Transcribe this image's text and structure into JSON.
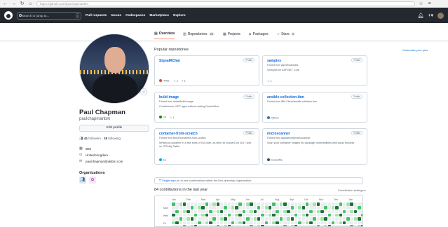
{
  "browser": {
    "url": "https://github.com/pauchapmanbm"
  },
  "header": {
    "search_placeholder": "Search or jump to...",
    "slash": "/",
    "nav": [
      "Pull requests",
      "Issues",
      "Codespaces",
      "Marketplace",
      "Explore"
    ]
  },
  "tabs": [
    {
      "label": "Overview",
      "icon": "book-icon",
      "active": true
    },
    {
      "label": "Repositories",
      "icon": "repo-icon",
      "count": "90"
    },
    {
      "label": "Projects",
      "icon": "table-icon"
    },
    {
      "label": "Packages",
      "icon": "package-icon"
    },
    {
      "label": "Stars",
      "icon": "star-icon",
      "count": "3"
    }
  ],
  "profile": {
    "name": "Paul Chapman",
    "login": "paulchapmanbm",
    "edit_label": "Edit profile",
    "followers": "41",
    "followers_label": "followers",
    "following": "19",
    "following_label": "following",
    "company": "IBM",
    "location": "United Kingdom",
    "email": "paulchapman@ukibm.com",
    "orgs_title": "Organizations"
  },
  "popular": {
    "title": "Popular repositories",
    "customize": "Customize your pins",
    "repos": [
      {
        "name": "SignalRChat",
        "badge": "Public",
        "desc": "",
        "lang": "HTML",
        "color": "#e34c26",
        "stars": "2",
        "forks": "3"
      },
      {
        "name": "samples",
        "badge": "Public",
        "fork": "Forked from aspnet/samples",
        "desc": "Samples for ASP.NET Core",
        "lang": "",
        "color": "",
        "stars": "1",
        "forks": ""
      },
      {
        "name": "build-image",
        "badge": "Public",
        "fork": "Forked from dotnet/build-image",
        "desc": "Containerize .NET apps without writing Dockerfiles.",
        "lang": "C#",
        "color": "#178600",
        "stars": "1",
        "forks": ""
      },
      {
        "name": "ansible-collection-ibm",
        "badge": "Public",
        "fork": "Forked from IBM-Cloud/ansible-collection-ibm",
        "desc": "",
        "lang": "Python",
        "color": "#3572A5",
        "stars": "",
        "forks": ""
      },
      {
        "name": "container-from-scratch",
        "badge": "Public",
        "fork": "Forked from lizrice/containers-from-scratch",
        "desc": "Writing a container in a few lines of Go code, as seen at DockerCon 2017 and on O'Reilly Safari",
        "lang": "Go",
        "color": "#00ADD8",
        "stars": "",
        "forks": ""
      },
      {
        "name": "microscanner",
        "badge": "Public",
        "fork": "Forked from aquasecurity/microscanner",
        "desc": "Scan your container images for package vulnerabilities with Aqua Security",
        "lang": "Dockerfile",
        "color": "#384d54",
        "stars": "",
        "forks": ""
      }
    ]
  },
  "banner": {
    "link": "Single sign-on",
    "text": "to see contributions within the ibm-openslap organization."
  },
  "contrib": {
    "title": "84 contributions in the last year",
    "settings": "Contribution settings ▾",
    "months": [
      "Jan",
      "Feb",
      "Mar",
      "Apr",
      "May",
      "Jun",
      "Jul",
      "Aug",
      "Sep",
      "Oct",
      "Nov",
      "Dec",
      "Jan",
      "Feb",
      "Mar",
      "Apr",
      "May"
    ],
    "days": [
      "Mon",
      "Wed",
      "Fri"
    ]
  }
}
